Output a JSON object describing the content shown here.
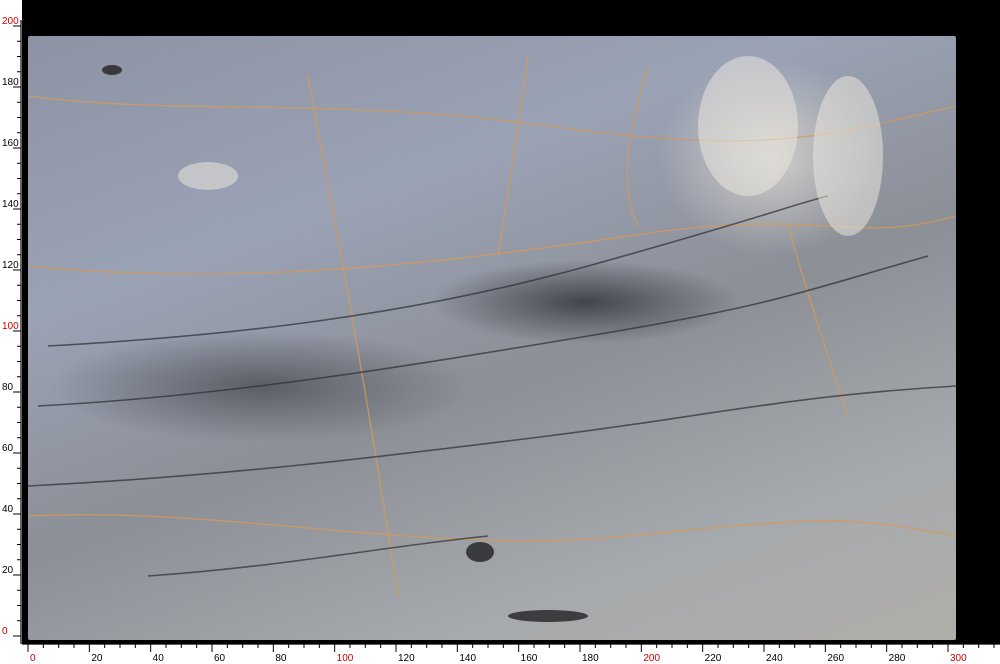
{
  "image": {
    "subject": "marble-slab",
    "background_color": "#000000",
    "slab_colors": [
      "#9aa2b5",
      "#8c8f96",
      "#3b3f45",
      "#d9a36a",
      "#e8e4dc"
    ]
  },
  "rulers": {
    "unit_color": "#cc0000",
    "tick_color": "#000000",
    "vertical": {
      "labels": [
        "0",
        "20",
        "40",
        "60",
        "80",
        "100",
        "120",
        "140",
        "160",
        "180",
        "200"
      ],
      "highlight": [
        "0",
        "100",
        "200"
      ]
    },
    "horizontal": {
      "labels": [
        "0",
        "20",
        "40",
        "60",
        "80",
        "100",
        "120",
        "140",
        "160",
        "180",
        "200",
        "220",
        "240",
        "260",
        "280",
        "300"
      ],
      "highlight": [
        "0",
        "100",
        "200",
        "300"
      ]
    }
  }
}
